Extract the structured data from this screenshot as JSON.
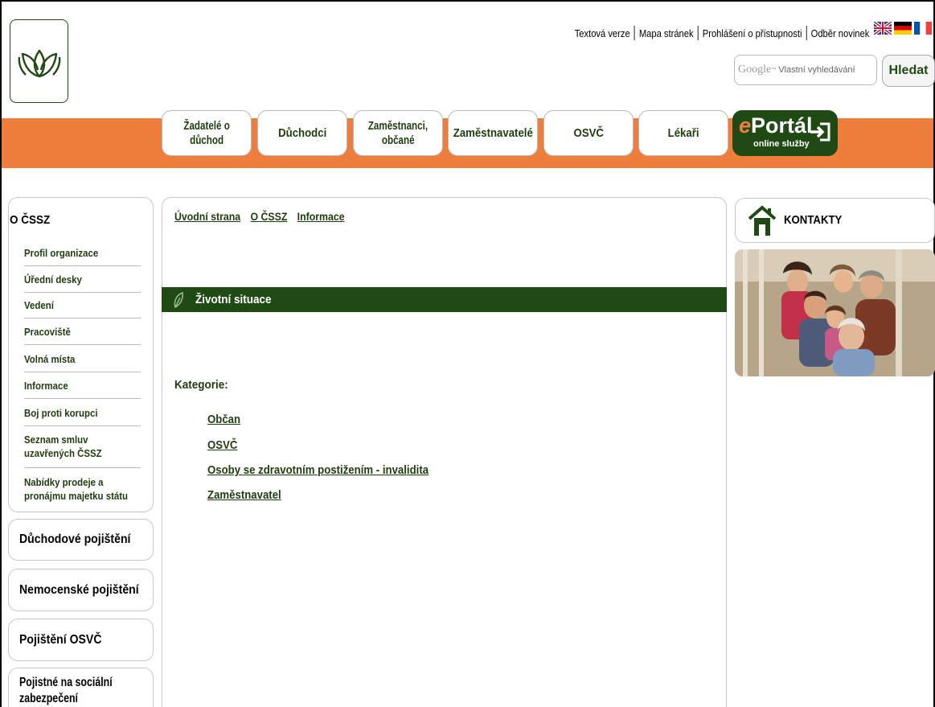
{
  "top_links": [
    {
      "label": "Textová verze"
    },
    {
      "label": "Mapa stránek"
    },
    {
      "label": "Prohlášení o přístupnosti"
    },
    {
      "label": "Odběr novinek"
    }
  ],
  "flags": [
    "uk-flag-icon",
    "de-flag-icon",
    "fr-flag-icon"
  ],
  "search": {
    "brand": "Google",
    "brand_tm": "™",
    "placeholder": "Vlastní vyhledávání",
    "button": "Hledat"
  },
  "nav_tabs": [
    {
      "line1": "Žadatelé o",
      "line2": "důchod"
    },
    {
      "line1": "Důchodci",
      "line2": ""
    },
    {
      "line1": "Zaměstnanci,",
      "line2": "občané"
    },
    {
      "line1": "Zaměstnavatelé",
      "line2": ""
    },
    {
      "line1": "OSVČ",
      "line2": ""
    },
    {
      "line1": "Lékaři",
      "line2": ""
    }
  ],
  "eportal": {
    "e": "e",
    "word": "Portál",
    "subtitle": "online služby"
  },
  "sidebar": {
    "heading": "O ČSSZ",
    "items": [
      {
        "line1": "Profil organizace",
        "line2": ""
      },
      {
        "line1": "Úřední desky",
        "line2": ""
      },
      {
        "line1": "Vedení",
        "line2": ""
      },
      {
        "line1": "Pracoviště",
        "line2": ""
      },
      {
        "line1": "Volná místa",
        "line2": ""
      },
      {
        "line1": "Informace",
        "line2": ""
      },
      {
        "line1": "Boj proti korupci",
        "line2": ""
      },
      {
        "line1": "Seznam smluv",
        "line2": "uzavřených ČSSZ"
      },
      {
        "line1": "Nabídky prodeje a",
        "line2": "pronájmu majetku státu"
      }
    ],
    "sections": [
      {
        "line1": "Důchodové pojištění",
        "line2": ""
      },
      {
        "line1": "Nemocenské pojištění",
        "line2": ""
      },
      {
        "line1": "Pojištění OSVČ",
        "line2": ""
      },
      {
        "line1": "Pojistné na sociální",
        "line2": "zabezpečení"
      }
    ]
  },
  "breadcrumb": [
    "Úvodní strana",
    "O ČSSZ",
    "Informace"
  ],
  "section_title": "Životní situace",
  "categories": {
    "label": "Kategorie:",
    "links": [
      "Občan",
      "OSVČ",
      "Osoby se zdravotním postižením - invalidita",
      "Zaměstnavatel"
    ]
  },
  "right": {
    "kontakty": "KONTAKTY"
  },
  "colors": {
    "orange": "#ef7d3c",
    "dark_green": "#1f4a13"
  }
}
